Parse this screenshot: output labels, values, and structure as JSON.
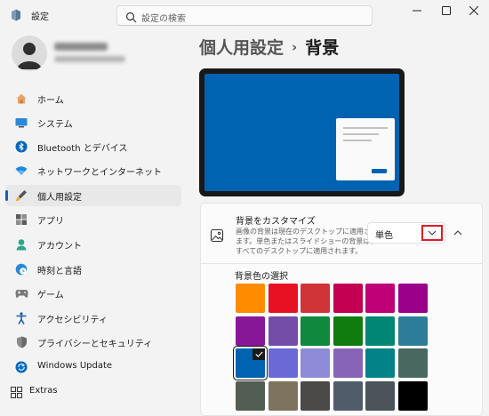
{
  "window": {
    "title": "設定",
    "search_placeholder": "設定の検索"
  },
  "user": {},
  "nav": [
    {
      "label": "ホーム",
      "icon": "home-icon"
    },
    {
      "label": "システム",
      "icon": "system-icon"
    },
    {
      "label": "Bluetooth とデバイス",
      "icon": "bluetooth-icon"
    },
    {
      "label": "ネットワークとインターネット",
      "icon": "network-icon"
    },
    {
      "label": "個人用設定",
      "icon": "personalization-icon",
      "active": true
    },
    {
      "label": "アプリ",
      "icon": "apps-icon"
    },
    {
      "label": "アカウント",
      "icon": "accounts-icon"
    },
    {
      "label": "時刻と言語",
      "icon": "time-language-icon"
    },
    {
      "label": "ゲーム",
      "icon": "gaming-icon"
    },
    {
      "label": "アクセシビリティ",
      "icon": "accessibility-icon"
    },
    {
      "label": "プライバシーとセキュリティ",
      "icon": "privacy-shield-icon"
    },
    {
      "label": "Windows Update",
      "icon": "windows-update-icon"
    },
    {
      "label": "Extras",
      "icon": "extras-icon"
    }
  ],
  "main": {
    "breadcrumb_parent": "個人用設定",
    "breadcrumb_current": "背景"
  },
  "customize": {
    "title": "背景をカスタマイズ",
    "description": "画像の背景は現在のデスクトップに適用されます。単色またはスライドショーの背景は、すべてのデスクトップに適用されます。",
    "dropdown_value": "単色"
  },
  "colors": {
    "section_title": "背景色の選択",
    "rows": [
      [
        "#ff8c00",
        "#e81123",
        "#d13438",
        "#c30052",
        "#bf0077",
        "#9a0089"
      ],
      [
        "#881798",
        "#744da9",
        "#10893e",
        "#107c10",
        "#018574",
        "#2d7d9a"
      ],
      [
        "#0063b1",
        "#6b69d6",
        "#8e8cd8",
        "#8764b8",
        "#038387",
        "#486860"
      ],
      [
        "#525e54",
        "#7e735f",
        "#4c4a48",
        "#515c6b",
        "#4a5459",
        "#000000"
      ]
    ],
    "selected": "#0063b1"
  }
}
